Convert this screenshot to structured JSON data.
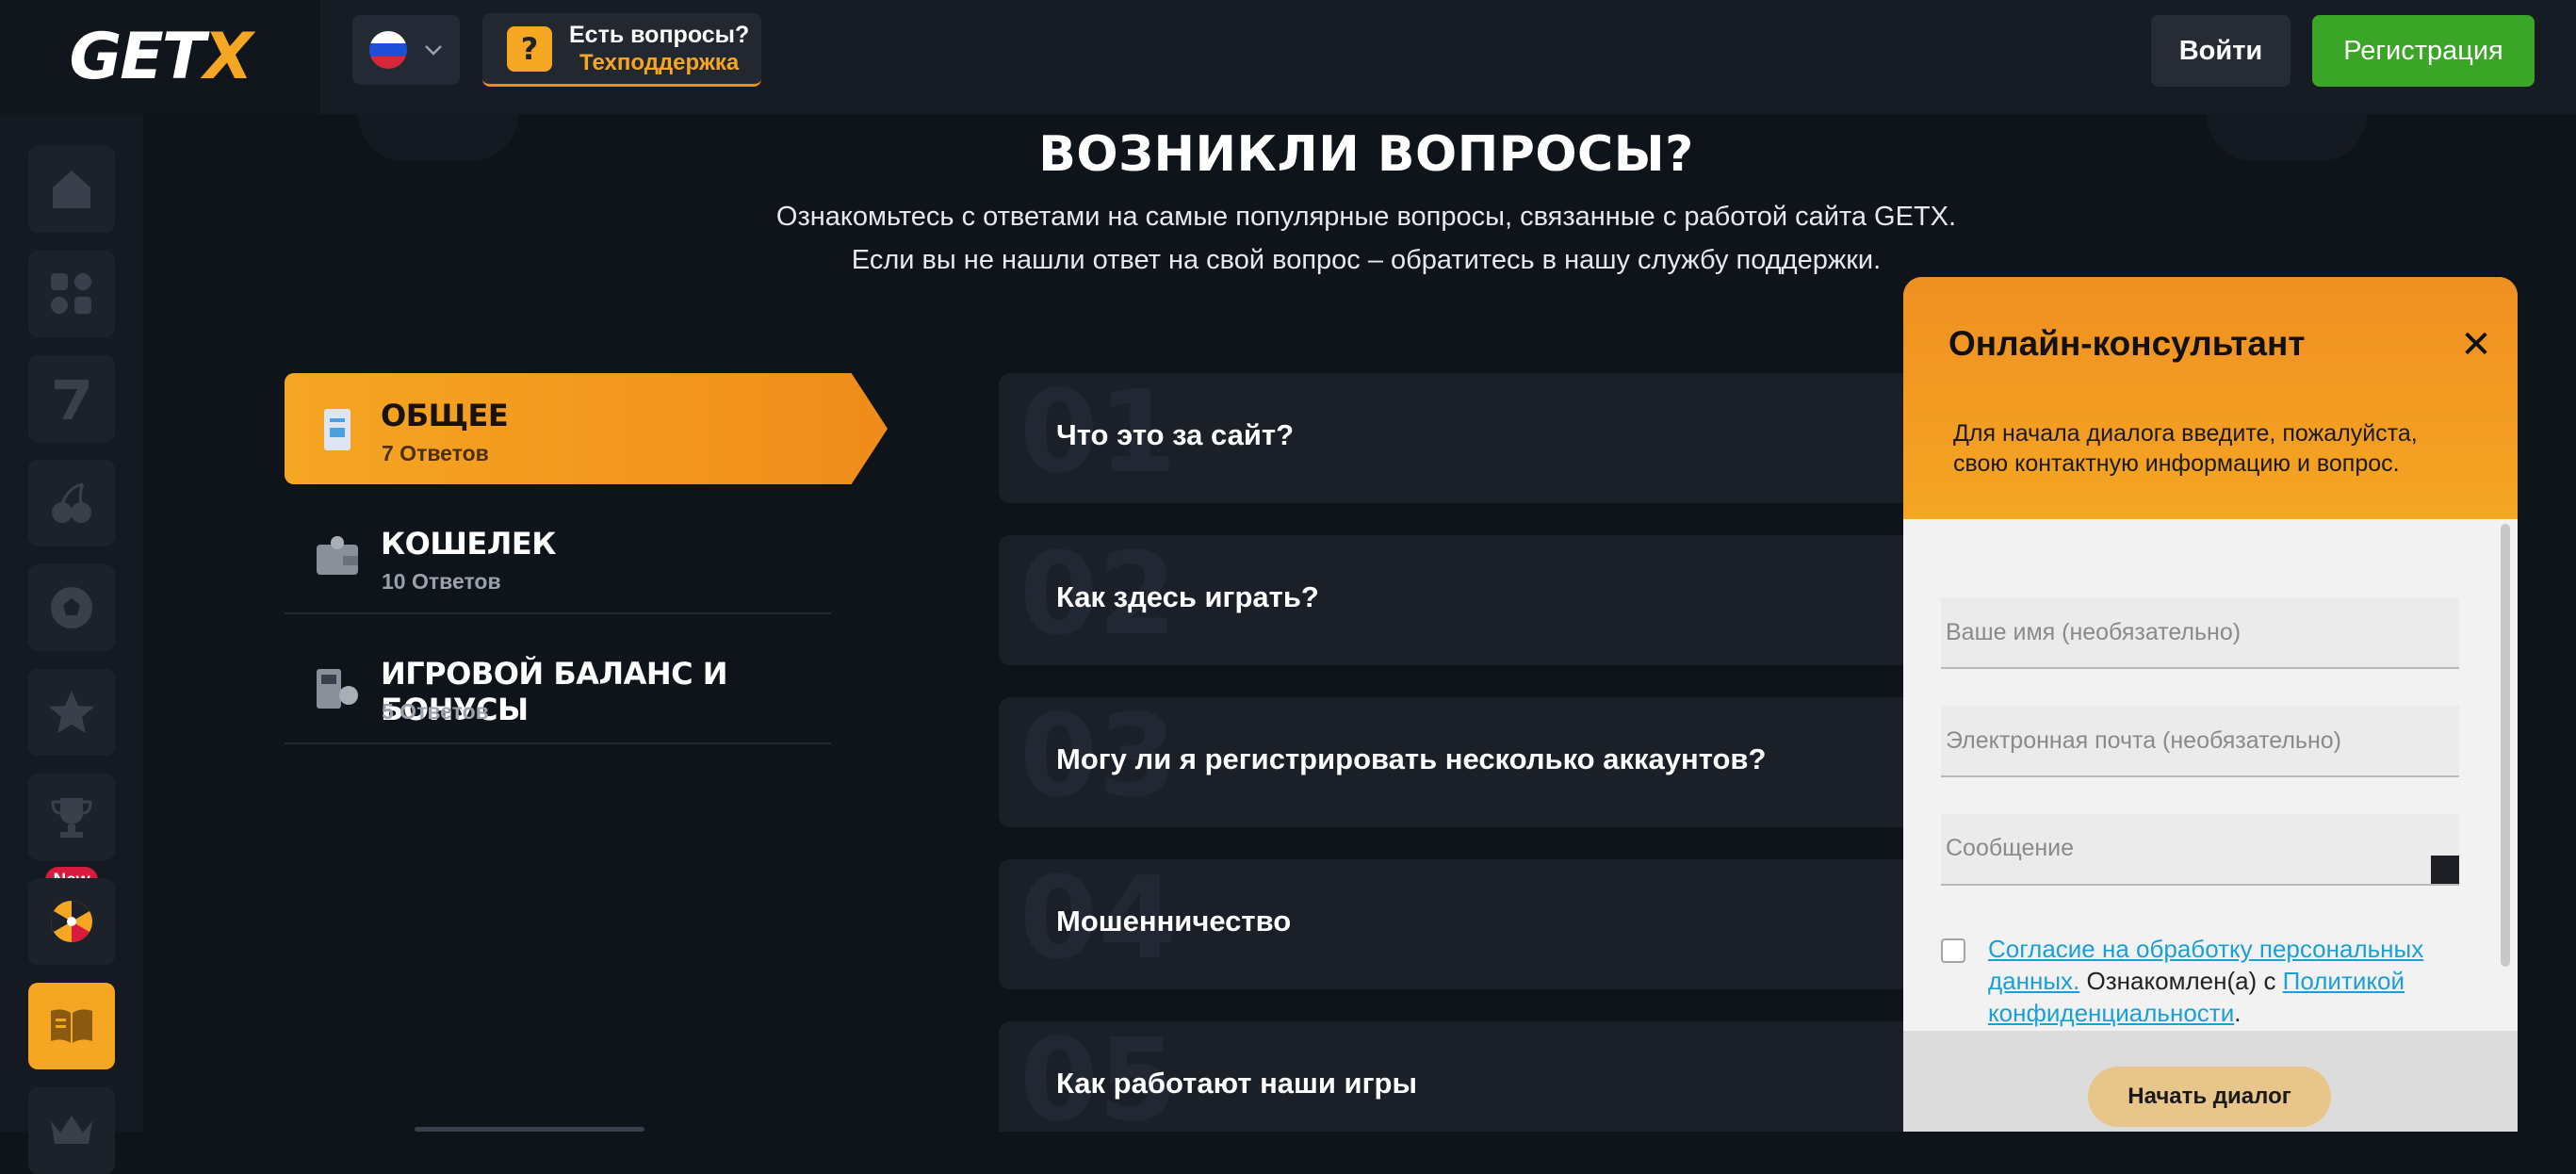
{
  "header": {
    "logo_main": "GET",
    "logo_accent": "X",
    "support_question": "Есть вопросы?",
    "support_label": "Техподдержка",
    "login": "Войти",
    "register": "Регистрация"
  },
  "sidebar": {
    "new_badge": "New",
    "items": [
      "home-icon",
      "apps-icon",
      "slots-seven-icon",
      "cherry-icon",
      "football-icon",
      "star-icon",
      "trophy-icon",
      "wheel-icon",
      "book-icon",
      "crown-icon"
    ]
  },
  "hero": {
    "title": "ВОЗНИКЛИ ВОПРОСЫ?",
    "line1": "Ознакомьтесь с ответами на самые популярные вопросы, связанные с работой сайта GETX.",
    "line2": "Если вы не нашли ответ на свой вопрос – обратитесь в нашу службу поддержки."
  },
  "categories": [
    {
      "title": "ОБЩЕЕ",
      "count": "7 Ответов"
    },
    {
      "title": "КОШЕЛЕК",
      "count": "10 Ответов"
    },
    {
      "title": "ИГРОВОЙ БАЛАНС И БОНУСЫ",
      "count": "5 Ответов"
    }
  ],
  "questions": [
    {
      "num": "01",
      "text": "Что это за сайт?"
    },
    {
      "num": "02",
      "text": "Как здесь играть?"
    },
    {
      "num": "03",
      "text": "Могу ли я регистрировать несколько аккаунтов?"
    },
    {
      "num": "04",
      "text": "Мошенничество"
    },
    {
      "num": "05",
      "text": "Как работают наши игры"
    }
  ],
  "chat": {
    "title": "Онлайн-консультант",
    "description": "Для начала диалога введите, пожалуйста, свою контактную информацию и вопрос.",
    "name_placeholder": "Ваше имя (необязательно)",
    "email_placeholder": "Электронная почта (необязательно)",
    "message_placeholder": "Сообщение",
    "consent_link1": "Согласие на обработку персональных данных.",
    "consent_middle": " Ознакомлен(а) с ",
    "consent_link2": "Политикой конфиденциальности",
    "consent_end": ".",
    "start_button": "Начать диалог"
  },
  "colors": {
    "accent": "#f5a623",
    "register_green": "#3aa527",
    "background": "#0f131a",
    "link": "#1a9fd6"
  }
}
